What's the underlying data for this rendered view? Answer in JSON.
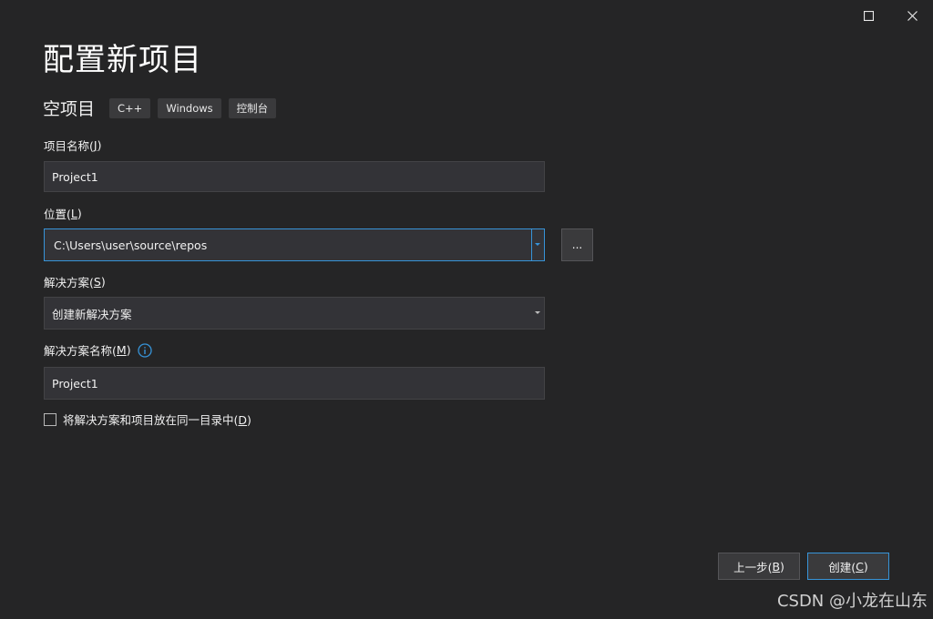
{
  "page": {
    "title": "配置新项目",
    "template_name": "空项目",
    "tags": [
      "C++",
      "Windows",
      "控制台"
    ]
  },
  "fields": {
    "project_name": {
      "label_text": "项目名称(",
      "label_mnemonic": "J",
      "label_suffix": ")",
      "value": "Project1"
    },
    "location": {
      "label_text": "位置(",
      "label_mnemonic": "L",
      "label_suffix": ")",
      "value": "C:\\Users\\user\\source\\repos",
      "browse_label": "..."
    },
    "solution": {
      "label_text": "解决方案(",
      "label_mnemonic": "S",
      "label_suffix": ")",
      "selected": "创建新解决方案"
    },
    "solution_name": {
      "label_text": "解决方案名称(",
      "label_mnemonic": "M",
      "label_suffix": ")",
      "value": "Project1"
    }
  },
  "checkbox": {
    "label_text": "将解决方案和项目放在同一目录中(",
    "label_mnemonic": "D",
    "label_suffix": ")",
    "checked": false
  },
  "buttons": {
    "back": {
      "text": "上一步(",
      "mnemonic": "B",
      "suffix": ")"
    },
    "create": {
      "text": "创建(",
      "mnemonic": "C",
      "suffix": ")"
    }
  },
  "watermark": "CSDN @小龙在山东",
  "colors": {
    "background": "#252526",
    "field": "#333337",
    "accent": "#3794d9"
  },
  "icons": {
    "maximize": "maximize-icon",
    "close": "close-icon",
    "info": "info-icon",
    "dropdown": "chevron-down-icon"
  }
}
